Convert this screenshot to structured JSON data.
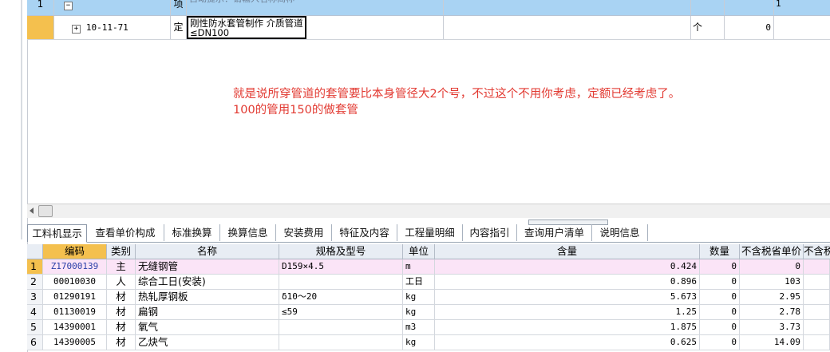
{
  "top_grid": {
    "row1": {
      "index": "1",
      "toggle": "−",
      "type": "项",
      "name_hint": "自动提示：请输入名称简称",
      "qty": "1"
    },
    "row2": {
      "toggle": "+",
      "code": "10-11-71",
      "type": "定",
      "name": "刚性防水套管制作 介质管道≤DN100",
      "unit": "个",
      "qty": "0"
    }
  },
  "annotation": {
    "line1": "就是说所穿管道的套管要比本身管径大2个号，不过这个不用你考虑，定额已经考虑了。",
    "line2": "100的管用150的做套管"
  },
  "tabs": [
    "工料机显示",
    "查看单价构成",
    "标准换算",
    "换算信息",
    "安装费用",
    "特征及内容",
    "工程量明细",
    "内容指引",
    "查询用户清单",
    "说明信息"
  ],
  "active_tab": 0,
  "bottom_grid": {
    "headers": [
      "编码",
      "类别",
      "名称",
      "规格及型号",
      "单位",
      "含量",
      "数量",
      "不含税省单价",
      "不含税"
    ],
    "rows": [
      {
        "n": "1",
        "code": "Z17000139",
        "cat": "主",
        "name": "无缝钢管",
        "spec": "D159×4.5",
        "unit": "m",
        "content": "0.424",
        "qty": "0",
        "price": "0"
      },
      {
        "n": "2",
        "code": "00010030",
        "cat": "人",
        "name": "综合工日(安装)",
        "spec": "",
        "unit": "工日",
        "content": "0.896",
        "qty": "0",
        "price": "103"
      },
      {
        "n": "3",
        "code": "01290191",
        "cat": "材",
        "name": "热轧厚钢板",
        "spec": "δ10～20",
        "unit": "kg",
        "content": "5.673",
        "qty": "0",
        "price": "2.95"
      },
      {
        "n": "4",
        "code": "01130019",
        "cat": "材",
        "name": "扁钢",
        "spec": "≤59",
        "unit": "kg",
        "content": "1.25",
        "qty": "0",
        "price": "2.78"
      },
      {
        "n": "5",
        "code": "14390001",
        "cat": "材",
        "name": "氧气",
        "spec": "",
        "unit": "m3",
        "content": "1.875",
        "qty": "0",
        "price": "3.73"
      },
      {
        "n": "6",
        "code": "14390005",
        "cat": "材",
        "name": "乙炔气",
        "spec": "",
        "unit": "kg",
        "content": "0.625",
        "qty": "0",
        "price": "14.09"
      }
    ]
  },
  "colors": {
    "header_row": "#a9d3f3",
    "selected_row": "#fbe4f7",
    "annotation": "#e23a32",
    "code_header": "#f4c04e"
  }
}
